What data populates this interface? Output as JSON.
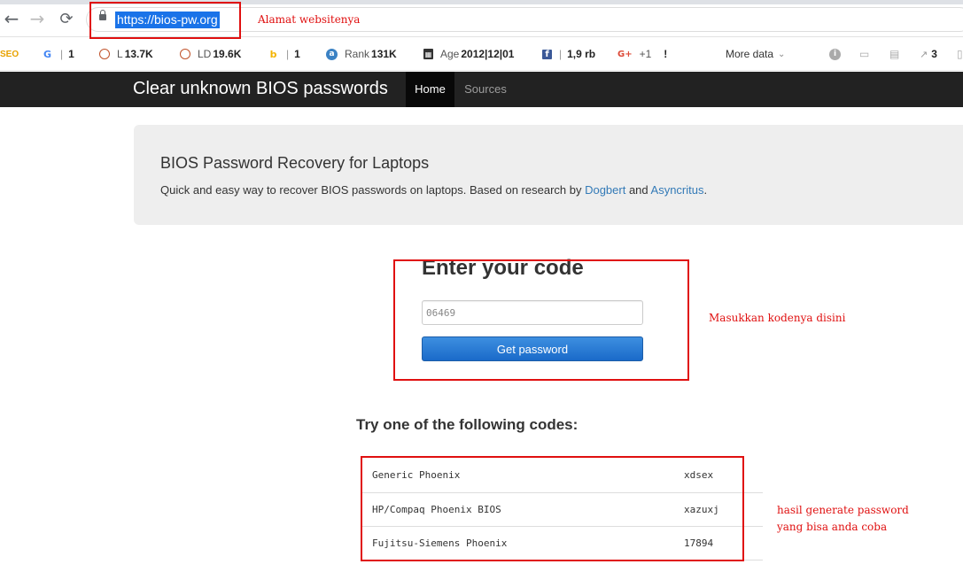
{
  "browser": {
    "url": "https://bios-pw.org",
    "back_glyph": "←",
    "forward_glyph": "→",
    "reload_glyph": "⟳"
  },
  "extension_bar": {
    "seo_logo": "SEO",
    "google": {
      "icon": "G",
      "value": "1"
    },
    "links": {
      "label": "L",
      "value": "13.7K"
    },
    "linking_domains": {
      "label": "LD",
      "value": "19.6K"
    },
    "bing": {
      "icon": "b",
      "value": "1"
    },
    "rank": {
      "label": "Rank",
      "value": "131K"
    },
    "age": {
      "label": "Age",
      "value": "2012|12|01"
    },
    "facebook": {
      "icon": "f",
      "value": "1,9 rb"
    },
    "gplus": {
      "icon": "G+",
      "value": "+1",
      "extra": "!"
    },
    "more_data": "More data",
    "external_links_value": "3"
  },
  "site_nav": {
    "brand": "Clear unknown BIOS passwords",
    "home": "Home",
    "sources": "Sources"
  },
  "jumbotron": {
    "title": "BIOS Password Recovery for Laptops",
    "desc_before": "Quick and easy way to recover BIOS passwords on laptops. Based on research by ",
    "link1": "Dogbert",
    "desc_between": " and ",
    "link2": "Asyncritus",
    "desc_after": "."
  },
  "form": {
    "heading": "Enter your code",
    "input_placeholder": "06469",
    "button_label": "Get password"
  },
  "results": {
    "heading": "Try one of the following codes:",
    "rows": [
      {
        "name": "Generic Phoenix",
        "password": "xdsex"
      },
      {
        "name": "HP/Compaq Phoenix BIOS",
        "password": "xazuxj"
      },
      {
        "name": "Fujitsu-Siemens Phoenix",
        "password": "17894"
      }
    ]
  },
  "annotations": {
    "url_note": "Alamat websitenya",
    "code_note": "Masukkan kodenya disini",
    "result_note_line1": "hasil generate password",
    "result_note_line2": "yang bisa anda coba",
    "color": "#e01010"
  }
}
